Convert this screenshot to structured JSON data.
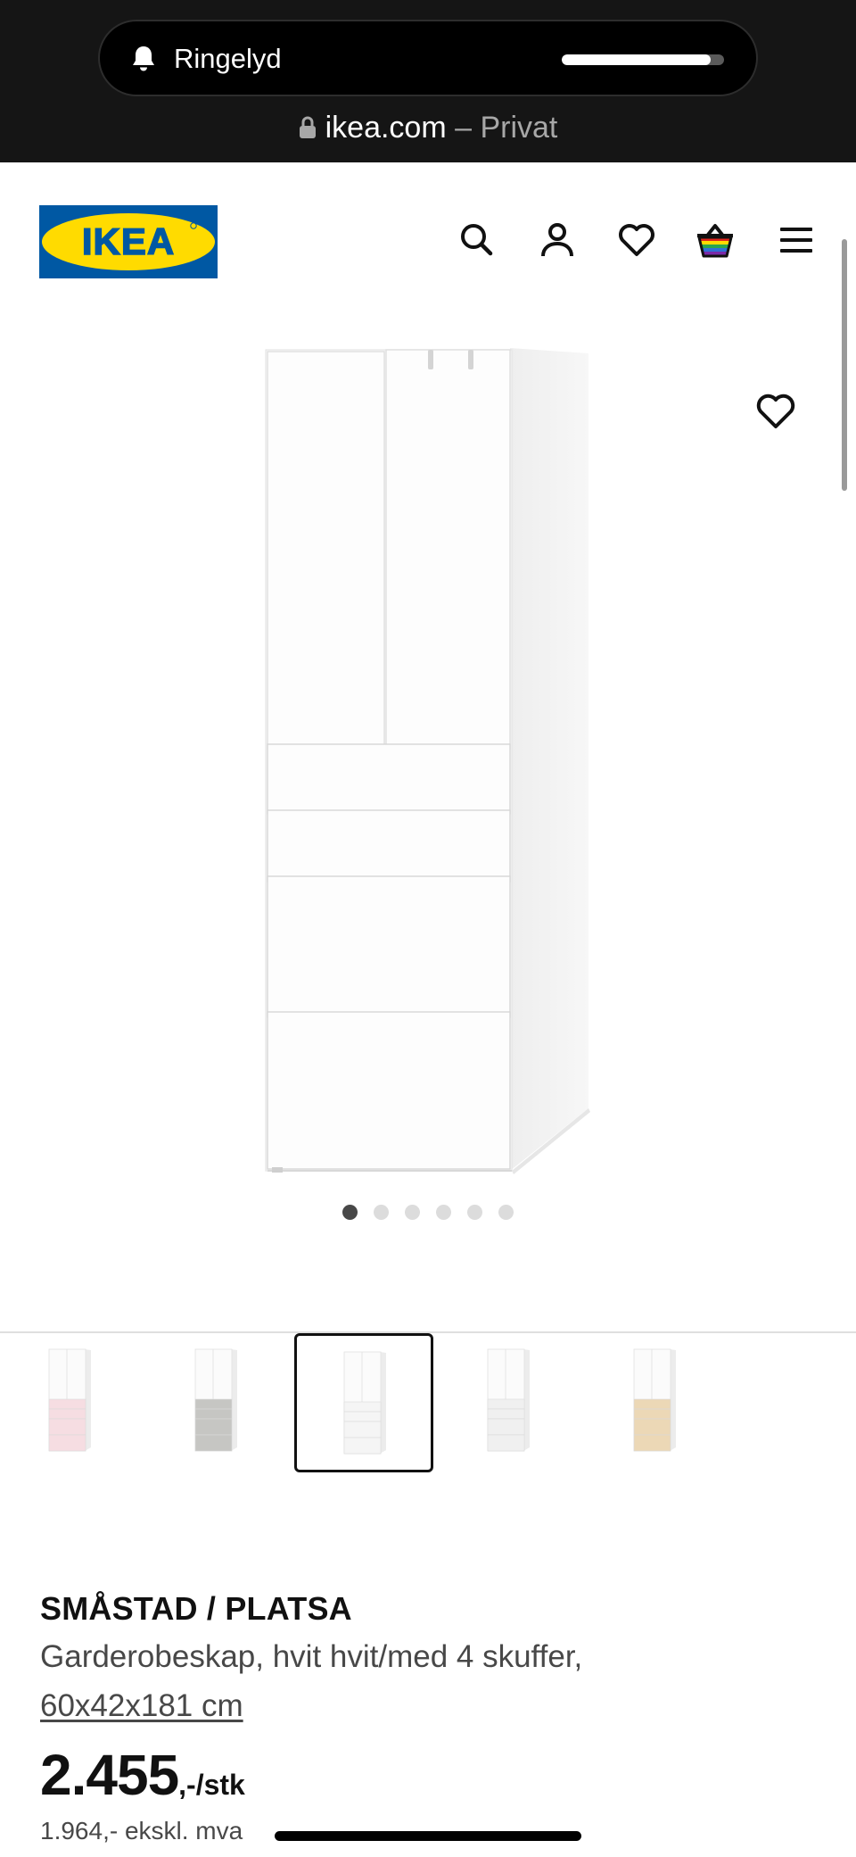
{
  "status_bar": {
    "ringer_label": "Ringelyd",
    "ringer_level": 0.92
  },
  "browser": {
    "domain": "ikea.com",
    "mode": " – Privat"
  },
  "header": {
    "logo_text": "IKEA",
    "brand_blue": "#0058a3",
    "brand_yellow": "#ffdb00",
    "icons": [
      "search-icon",
      "account-icon",
      "favourites-icon",
      "shopping-bag-icon",
      "menu-icon"
    ]
  },
  "gallery": {
    "image_count": 6,
    "active_index": 0
  },
  "variants": [
    {
      "color": "pink",
      "drawer_fill": "#f6dde2"
    },
    {
      "color": "grey",
      "drawer_fill": "#c6c6c3"
    },
    {
      "color": "white",
      "drawer_fill": "#f5f5f5",
      "selected": true
    },
    {
      "color": "white",
      "drawer_fill": "#f0f0f0"
    },
    {
      "color": "birch",
      "drawer_fill": "#ecd8b6"
    }
  ],
  "product": {
    "name": "SMÅSTAD / PLATSA",
    "description": "Garderobeskap, hvit hvit/med 4 skuffer,",
    "dimensions": "60x42x181 cm",
    "price_integer": "2.455",
    "price_suffix": ",-/stk",
    "price_ex_vat": "1.964,- ekskl. mva"
  }
}
